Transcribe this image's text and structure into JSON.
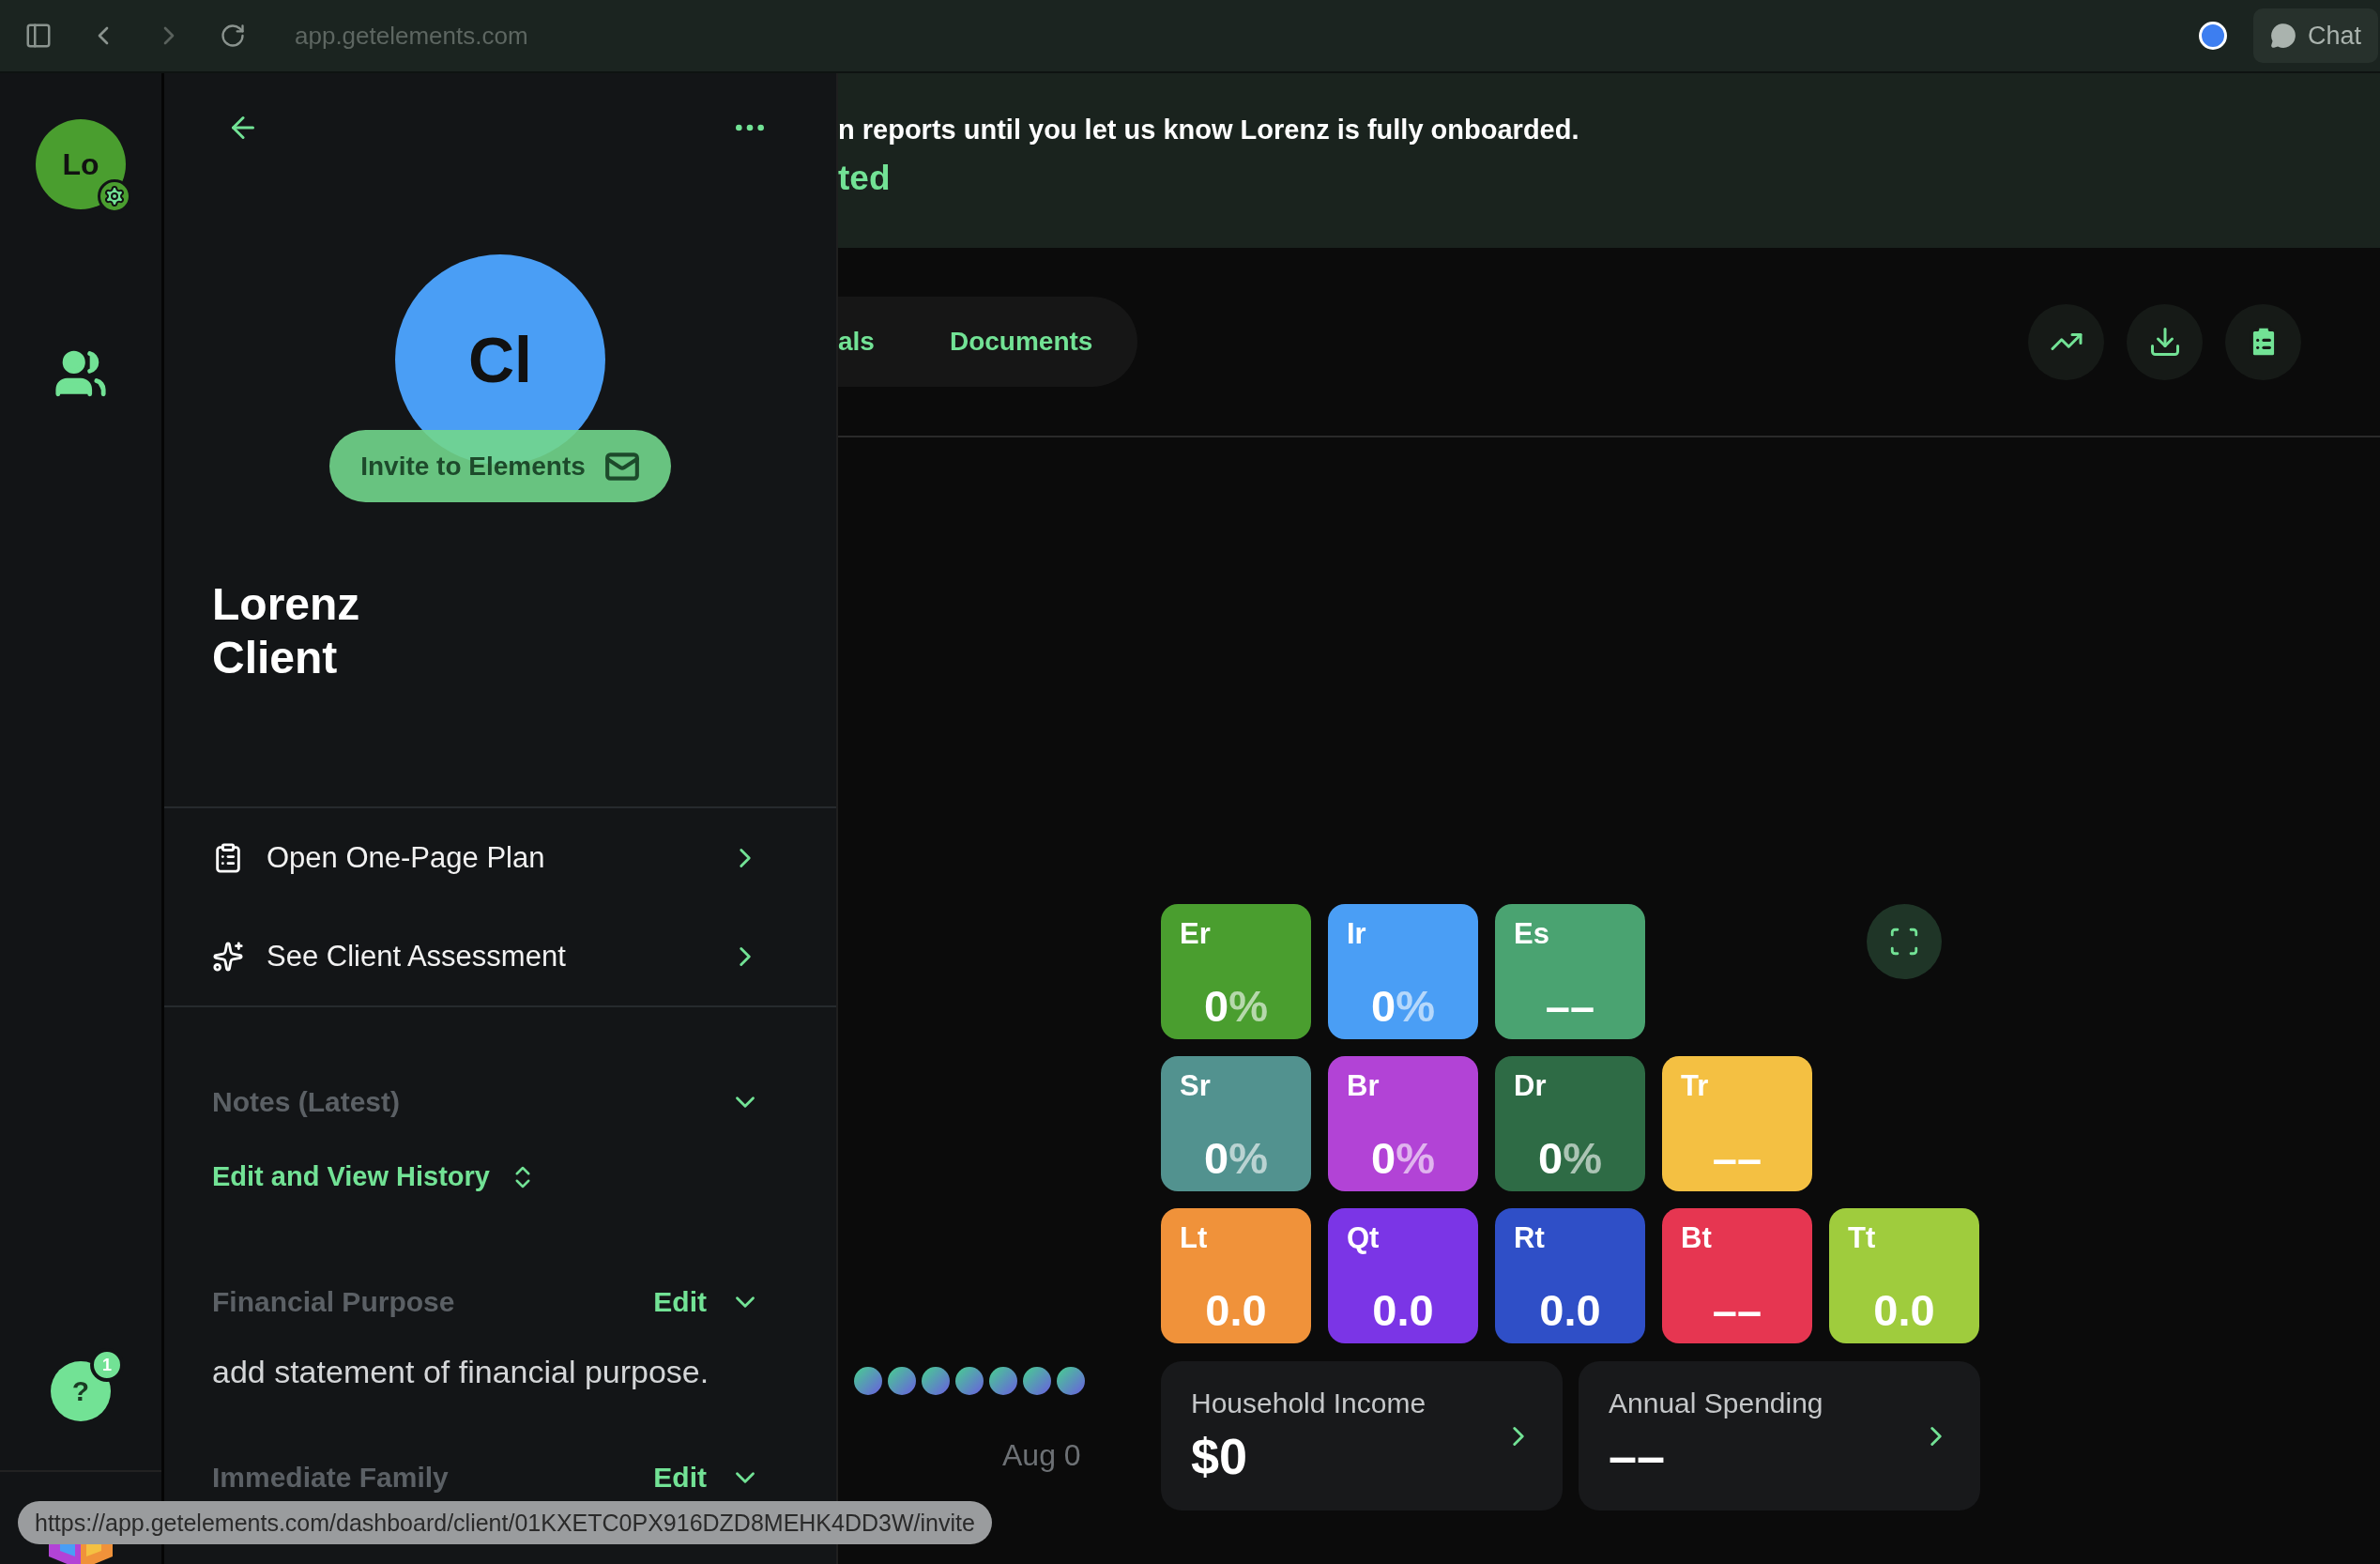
{
  "browser": {
    "url": "app.getelements.com",
    "chat_button": "Chat"
  },
  "nav_rail": {
    "avatar": "Lo",
    "help": "?",
    "help_badge": "1"
  },
  "drawer": {
    "avatar": "Cl",
    "invite_button": "Invite to Elements",
    "name": "Lorenz Client",
    "actions": [
      {
        "kind": "plan",
        "label": "Open One-Page Plan"
      },
      {
        "kind": "assessment",
        "label": "See Client Assessment"
      }
    ],
    "notes": {
      "title": "Notes (Latest)",
      "link": "Edit and View History"
    },
    "sections": [
      {
        "title": "Financial Purpose",
        "edit": "Edit",
        "text": "add statement of financial purpose."
      },
      {
        "title": "Immediate Family",
        "edit": "Edit"
      }
    ]
  },
  "banner": {
    "message": "n reports until you let us know Lorenz is fully onboarded.",
    "link": "ted"
  },
  "tabs": [
    {
      "label": "als",
      "selected": false
    },
    {
      "label": "Documents",
      "selected": false
    }
  ],
  "date": "Aug 0",
  "tiles": [
    [
      {
        "label": "Er",
        "value": "0",
        "unit": "%",
        "color": "#4a9e2f"
      },
      {
        "label": "Ir",
        "value": "0",
        "unit": "%",
        "color": "#4a9ef5"
      },
      {
        "label": "Es",
        "value": "––",
        "color": "#4aa371"
      }
    ],
    [
      {
        "label": "Sr",
        "value": "0",
        "unit": "%",
        "color": "#52928f"
      },
      {
        "label": "Br",
        "value": "0",
        "unit": "%",
        "color": "#b243d6"
      },
      {
        "label": "Dr",
        "value": "0",
        "unit": "%",
        "color": "#2e6b45"
      },
      {
        "label": "Tr",
        "value": "––",
        "color": "#f4c042"
      }
    ],
    [
      {
        "label": "Lt",
        "value": "0.0",
        "color": "#f0923a"
      },
      {
        "label": "Qt",
        "value": "0.0",
        "color": "#7b35e6"
      },
      {
        "label": "Rt",
        "value": "0.0",
        "color": "#2f4fc7"
      },
      {
        "label": "Bt",
        "value": "––",
        "color": "#e63651"
      },
      {
        "label": "Tt",
        "value": "0.0",
        "color": "#9fcc3d"
      }
    ]
  ],
  "cards": [
    {
      "title": "Household Income",
      "value": "$0"
    },
    {
      "title": "Annual Spending",
      "value": "––"
    }
  ],
  "status_url": "https://app.getelements.com/dashboard/client/01KXETC0PX916DZD8MEHK4DD3W/invite"
}
